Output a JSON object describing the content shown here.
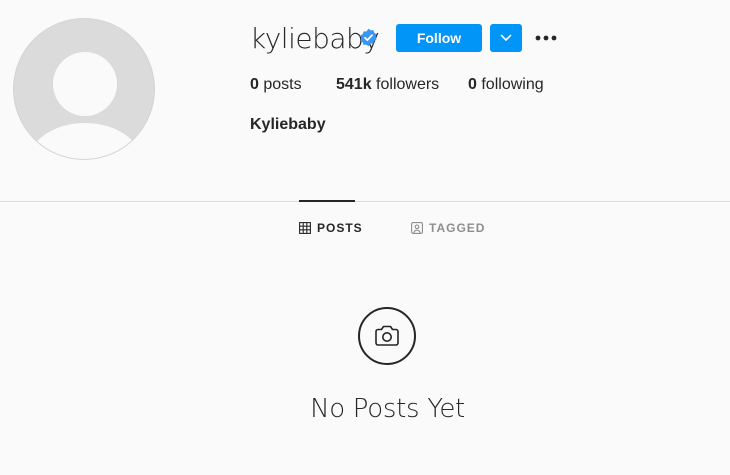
{
  "profile": {
    "username": "kyliebaby",
    "full_name": "Kyliebaby",
    "verified": true,
    "avatar_icon": "default-avatar-icon",
    "accent_color": "#0095f6"
  },
  "actions": {
    "follow_label": "Follow",
    "dropdown_icon": "chevron-down-icon",
    "more_icon": "more-options-icon"
  },
  "stats": {
    "posts_count": "0",
    "posts_label": "posts",
    "followers_count": "541k",
    "followers_label": "followers",
    "following_count": "0",
    "following_label": "following"
  },
  "tabs": [
    {
      "label": "POSTS",
      "icon": "grid-icon",
      "active": true
    },
    {
      "label": "TAGGED",
      "icon": "tagged-icon",
      "active": false
    }
  ],
  "empty_state": {
    "icon": "camera-icon",
    "message": "No Posts Yet"
  }
}
